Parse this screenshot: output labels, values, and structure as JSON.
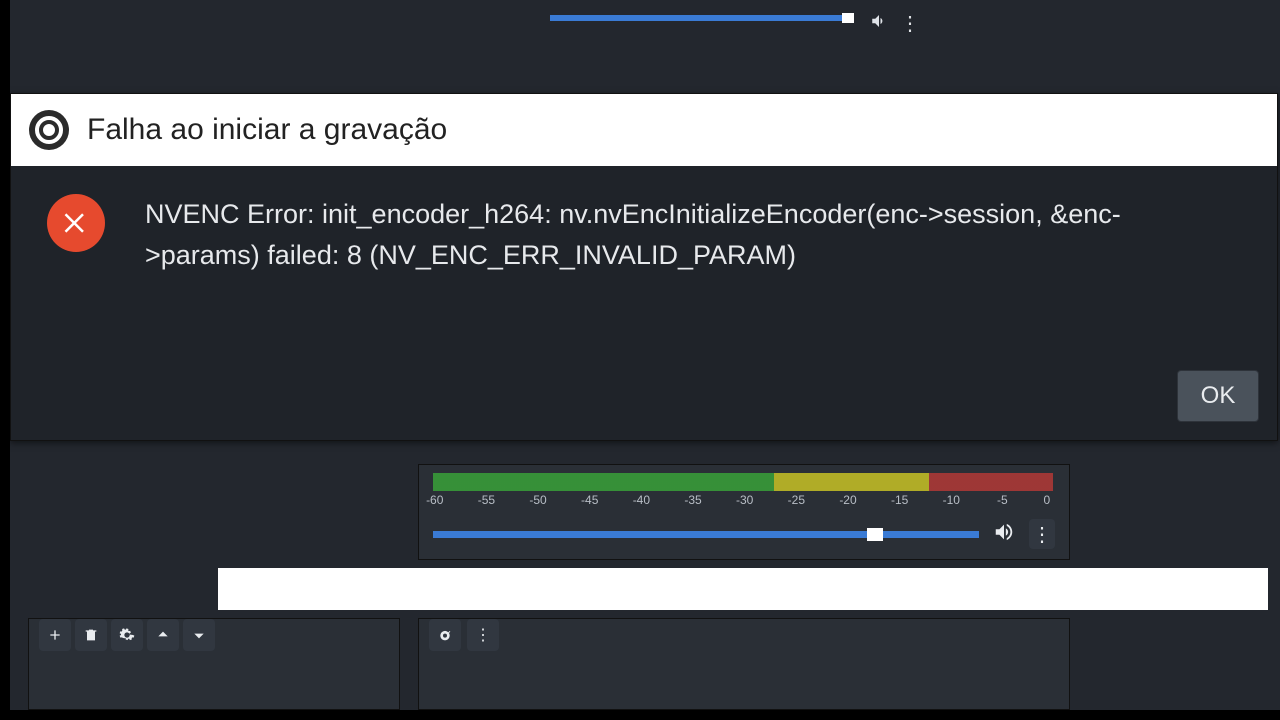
{
  "dialog": {
    "title": "Falha ao iniciar a gravação",
    "message": "NVENC Error: init_encoder_h264: nv.nvEncInitializeEncoder(enc->session, &enc->params) failed: 8 (NV_ENC_ERR_INVALID_PARAM)",
    "ok_label": "OK"
  },
  "mixer": {
    "db_ticks": [
      "-60",
      "-55",
      "-50",
      "-45",
      "-40",
      "-35",
      "-30",
      "-25",
      "-20",
      "-15",
      "-10",
      "-5",
      "0"
    ],
    "volume_percent": 84
  },
  "toolbar": {
    "add": "+",
    "delete": "🗑",
    "settings": "⚙",
    "up": "˄",
    "down": "˅"
  }
}
